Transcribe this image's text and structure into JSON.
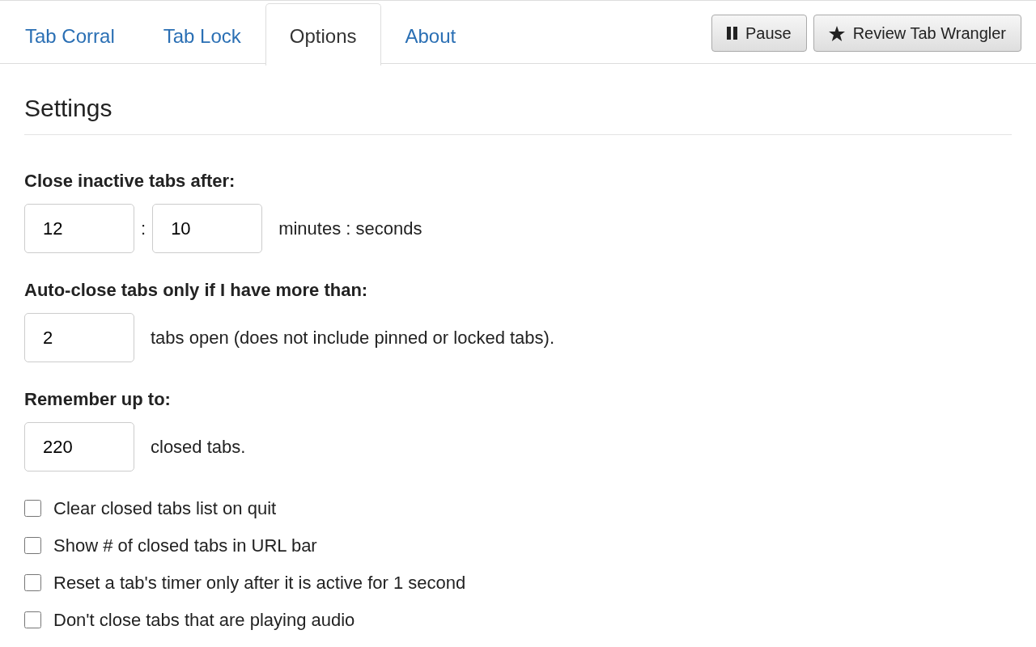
{
  "tabs": [
    {
      "label": "Tab Corral",
      "selected": false
    },
    {
      "label": "Tab Lock",
      "selected": false
    },
    {
      "label": "Options",
      "selected": true
    },
    {
      "label": "About",
      "selected": false
    }
  ],
  "toolbar_buttons": [
    {
      "label": "Pause",
      "kind": "pause"
    },
    {
      "label": "Review Tab Wrangler",
      "kind": "review"
    }
  ],
  "heading": "Settings",
  "settings": [
    {
      "label": "Close inactive tabs after:",
      "inputs": [
        {
          "value": "12"
        },
        {
          "value": "10"
        }
      ],
      "separator": ":",
      "suffix": "minutes : seconds"
    },
    {
      "label": "Auto-close tabs only if I have more than:",
      "inputs": [
        {
          "value": "2"
        }
      ],
      "suffix": "tabs open (does not include pinned or locked tabs)."
    },
    {
      "label": "Remember up to:",
      "inputs": [
        {
          "value": "220"
        }
      ],
      "suffix": "closed tabs."
    }
  ],
  "checkboxes": [
    {
      "label": "Clear closed tabs list on quit",
      "checked": false
    },
    {
      "label": "Show # of closed tabs in URL bar",
      "checked": false
    },
    {
      "label": "Reset a tab's timer only after it is active for 1 second",
      "checked": false
    },
    {
      "label": "Don't close tabs that are playing audio",
      "checked": false
    }
  ]
}
